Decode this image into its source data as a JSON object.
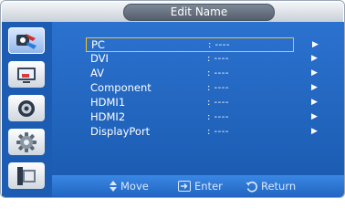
{
  "window": {
    "title": "Edit Name"
  },
  "colors": {
    "panel": "#1c5db3",
    "selection": "#f3c220",
    "text": "#ffffff"
  },
  "sidebar": {
    "tabs": [
      {
        "icon": "picture-mode-icon",
        "selected": true
      },
      {
        "icon": "display-icon",
        "selected": false
      },
      {
        "icon": "sound-icon",
        "selected": false
      },
      {
        "icon": "gear-icon",
        "selected": false
      },
      {
        "icon": "multi-screen-icon",
        "selected": false
      }
    ]
  },
  "menu": {
    "items": [
      {
        "label": "PC",
        "value": ": ----",
        "selected": true
      },
      {
        "label": "DVI",
        "value": ": ----"
      },
      {
        "label": "AV",
        "value": ": ----"
      },
      {
        "label": "Component",
        "value": ": ----"
      },
      {
        "label": "HDMI1",
        "value": ": ----"
      },
      {
        "label": "HDMI2",
        "value": ": ----"
      },
      {
        "label": "DisplayPort",
        "value": ": ----"
      }
    ],
    "arrow": "▶"
  },
  "footer": {
    "move": "Move",
    "enter": "Enter",
    "return": "Return"
  }
}
